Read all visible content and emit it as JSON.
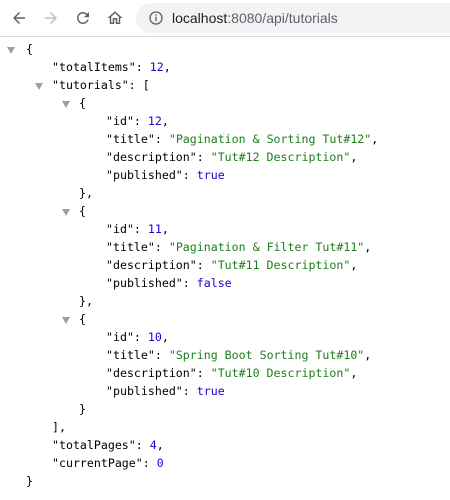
{
  "browser": {
    "url_host": "localhost",
    "url_rest": ":8080/api/tutorials",
    "icons": {
      "back": "arrow-left-icon",
      "forward": "arrow-right-icon",
      "reload": "reload-icon",
      "home": "home-icon",
      "info": "info-icon"
    }
  },
  "json": {
    "open_brace": "{",
    "close_brace": "}",
    "totalItems_key": "\"totalItems\"",
    "totalItems_value": "12",
    "tutorials_key": "\"tutorials\"",
    "array_open": "[",
    "array_close": "],",
    "totalPages_key": "\"totalPages\"",
    "totalPages_value": "4",
    "currentPage_key": "\"currentPage\"",
    "currentPage_value": "0",
    "tutorials": [
      {
        "id_key": "\"id\"",
        "id": "12",
        "title_key": "\"title\"",
        "title": "\"Pagination & Sorting Tut#12\"",
        "description_key": "\"description\"",
        "description": "\"Tut#12 Description\"",
        "published_key": "\"published\"",
        "published": "true"
      },
      {
        "id_key": "\"id\"",
        "id": "11",
        "title_key": "\"title\"",
        "title": "\"Pagination & Filter Tut#11\"",
        "description_key": "\"description\"",
        "description": "\"Tut#11 Description\"",
        "published_key": "\"published\"",
        "published": "false"
      },
      {
        "id_key": "\"id\"",
        "id": "10",
        "title_key": "\"title\"",
        "title": "\"Spring Boot Sorting Tut#10\"",
        "description_key": "\"description\"",
        "description": "\"Tut#10 Description\"",
        "published_key": "\"published\"",
        "published": "true"
      }
    ]
  }
}
